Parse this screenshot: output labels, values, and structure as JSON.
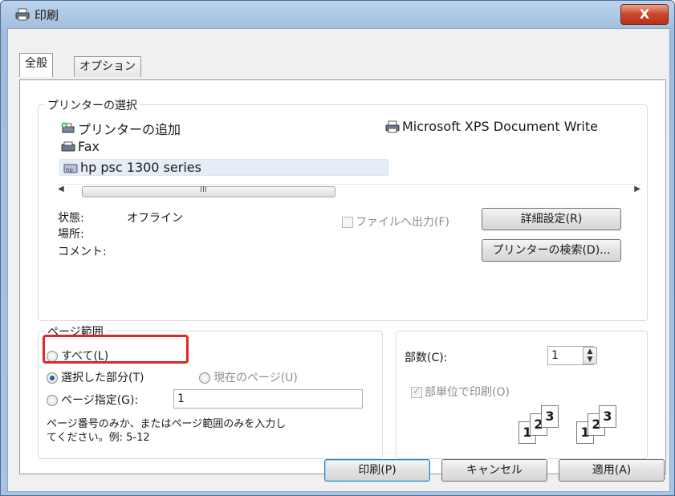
{
  "window": {
    "title": "印刷",
    "close_label": "X"
  },
  "tabs": [
    {
      "label": "全般"
    },
    {
      "label": "オプション"
    }
  ],
  "printer_group": {
    "title": "プリンターの選択",
    "items": [
      {
        "label": "プリンターの追加",
        "icon": "add-printer-icon"
      },
      {
        "label": "Microsoft XPS Document Write",
        "icon": "printer-icon"
      },
      {
        "label": "Fax",
        "icon": "fax-icon"
      },
      {
        "label": "hp psc 1300 series",
        "icon": "printer-icon",
        "selected": true
      }
    ],
    "status_label": "状態:",
    "status_value": "オフライン",
    "location_label": "場所:",
    "comment_label": "コメント:",
    "print_to_file_label": "ファイルへ出力(F)",
    "preferences_button": "詳細設定(R)",
    "find_printer_button": "プリンターの検索(D)...",
    "scroll_thumb_grip": "III"
  },
  "page_range": {
    "title": "ページ範囲",
    "all_label": "すべて(L)",
    "selection_label": "選択した部分(T)",
    "current_page_label": "現在のページ(U)",
    "pages_label": "ページ指定(G):",
    "pages_value": "1",
    "hint": "ページ番号のみか、またはページ範囲のみを入力し",
    "hint2": "てください。例: 5-12",
    "selected_option": "selection"
  },
  "copies": {
    "count_label": "部数(C):",
    "count_value": "1",
    "collate_label": "部単位で印刷(O)",
    "collate_checked": true,
    "collate_pages": [
      "1",
      "2",
      "3"
    ]
  },
  "footer": {
    "print_button": "印刷(P)",
    "cancel_button": "キャンセル",
    "apply_button": "適用(A)"
  },
  "colors": {
    "highlight": "#e0262b",
    "close_red": "#c9462c"
  }
}
